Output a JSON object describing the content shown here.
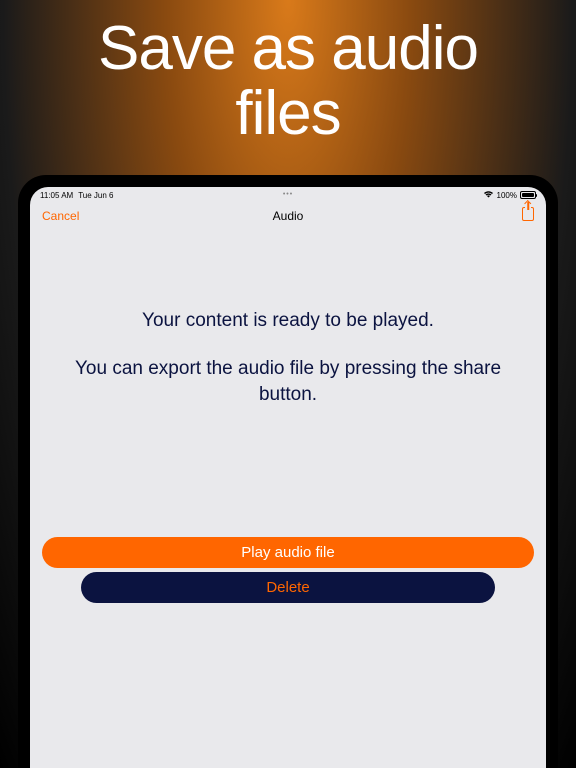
{
  "promo": {
    "title_line1": "Save as audio",
    "title_line2": "files"
  },
  "status": {
    "time": "11:05 AM",
    "date": "Tue Jun 6",
    "battery_pct": "100%"
  },
  "nav": {
    "cancel": "Cancel",
    "title": "Audio"
  },
  "content": {
    "ready": "Your content is ready to be played.",
    "export_hint": "You can export the audio file by pressing the share button."
  },
  "buttons": {
    "play": "Play audio file",
    "delete": "Delete"
  }
}
